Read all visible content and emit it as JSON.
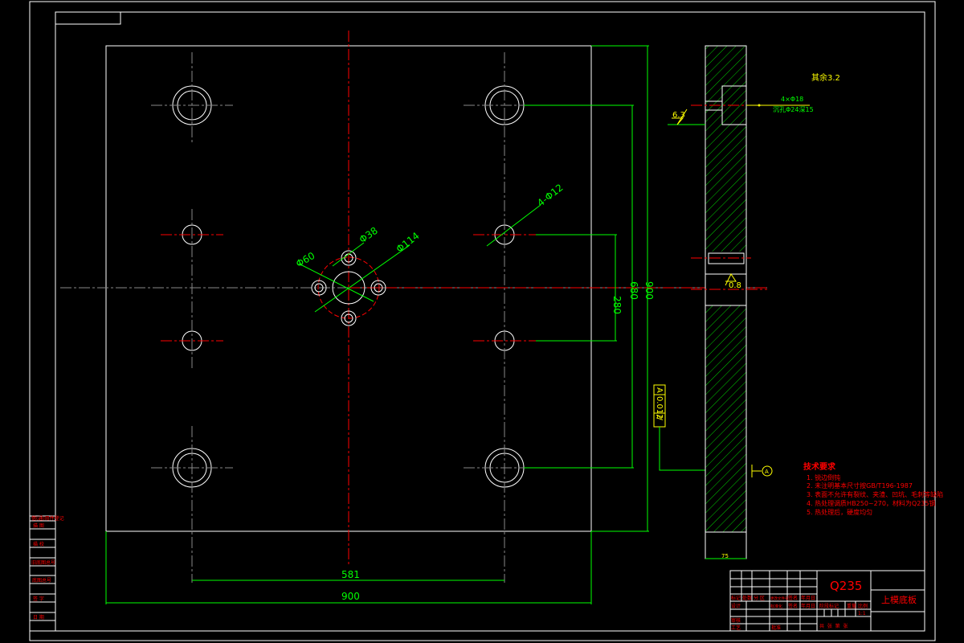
{
  "drawing": {
    "colors": {
      "outline": "#ffffff",
      "dimension": "#00ff00",
      "centerline": "#ff0000",
      "annotation": "#ffff00",
      "text": "#ff0000"
    },
    "dimensions": {
      "bottom_inner": "581",
      "bottom_overall": "900",
      "right_inner": "280",
      "right_mid": "680",
      "right_overall": "900",
      "hole_small": "4-Φ12",
      "center_pcd": "Φ114",
      "center_hole": "Φ60",
      "center_small_hole": "Φ38",
      "side_thickness": "75"
    },
    "annotations": {
      "counterbore_count": "4×Φ18",
      "counterbore_spec": "沉孔Φ24深15",
      "roughness_main": "6.3",
      "roughness_center": "0.8",
      "roughness_rest": "其余3.2",
      "tolerance_symbol": "//",
      "tolerance_value": "0.012",
      "tolerance_datum": "A",
      "datum_label": "A"
    },
    "technical_requirements": {
      "title": "技术要求",
      "items": [
        "1. 锐边倒钝",
        "2. 未注明基本尺寸按GB/T196-1987",
        "3. 表面不允许有裂纹、夹渣、凹坑、毛刺等缺陷",
        "4. 热处理调质HB250~270，材料为Q235钢",
        "5. 热处理后，硬度均匀"
      ]
    },
    "side_stamp": [
      "借(通)用件登记",
      "描 图",
      "描 校",
      "旧底图总号",
      "底图总号",
      "签 字",
      "日 期"
    ],
    "title_block": {
      "material": "Q235",
      "part_name": "上模底板",
      "row_labels": [
        "标记",
        "处数",
        "分 区",
        "更改文件号",
        "签名",
        "年月日"
      ],
      "design": "设计",
      "standardization": "标准化",
      "signature": "签名",
      "date": "年月日",
      "review": "审核",
      "craft": "工艺",
      "approve": "批准",
      "stage_mark": "阶段标记",
      "weight": "重量",
      "scale": "比例",
      "scale_value": "1:1",
      "sheets": "共  张  第  张"
    }
  }
}
